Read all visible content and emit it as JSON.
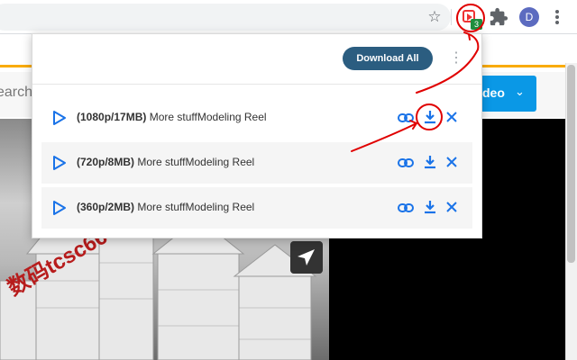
{
  "toolbar": {
    "badge_count": "3",
    "avatar_letter": "D"
  },
  "page": {
    "search_placeholder": "earch",
    "video_button_label": "deo",
    "watermark": "数码tcsc66"
  },
  "popup": {
    "download_all_label": "Download All",
    "items": [
      {
        "quality": "(1080p/17MB)",
        "title": "More stuffModeling Reel"
      },
      {
        "quality": "(720p/8MB)",
        "title": "More stuffModeling Reel"
      },
      {
        "quality": "(360p/2MB)",
        "title": "More stuffModeling Reel"
      }
    ]
  },
  "colors": {
    "accent_blue": "#1a73e8",
    "download_all_bg": "#2b5d80",
    "annotation_red": "#e00000"
  }
}
